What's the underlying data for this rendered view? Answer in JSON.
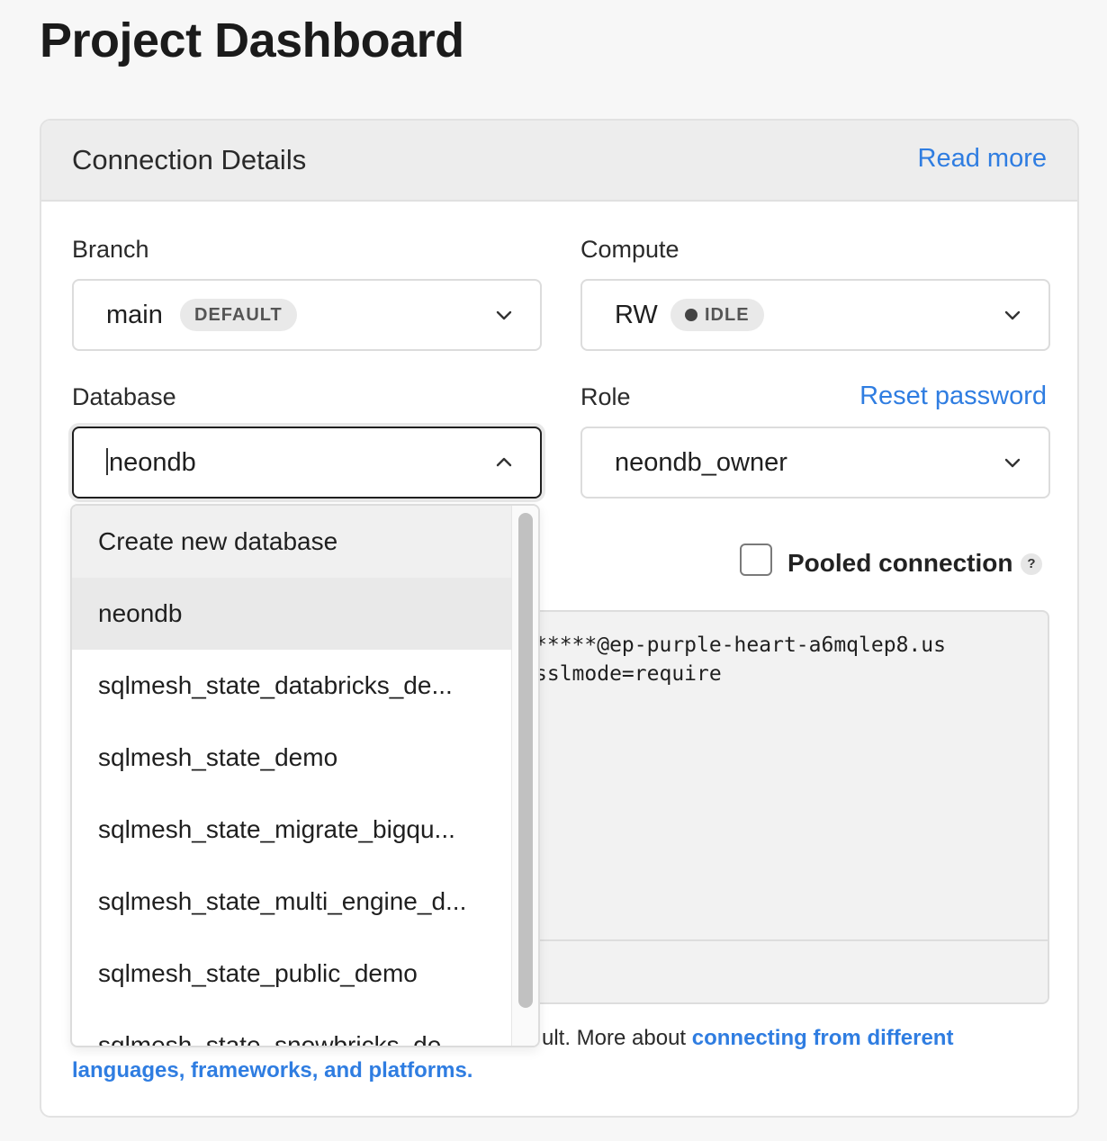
{
  "page": {
    "title": "Project Dashboard"
  },
  "connection": {
    "header_title": "Connection Details",
    "read_more": "Read more",
    "branch": {
      "label": "Branch",
      "value": "main",
      "badge": "DEFAULT"
    },
    "compute": {
      "label": "Compute",
      "value": "RW",
      "status": "IDLE"
    },
    "database": {
      "label": "Database",
      "value": "neondb",
      "options": [
        "Create new database",
        "neondb",
        "sqlmesh_state_databricks_de...",
        "sqlmesh_state_demo",
        "sqlmesh_state_migrate_bigqu...",
        "sqlmesh_state_multi_engine_d...",
        "sqlmesh_state_public_demo",
        "sqlmesh_state_snowbricks_de..."
      ]
    },
    "role": {
      "label": "Role",
      "value": "neondb_owner",
      "reset_password": "Reset password"
    },
    "pooled": {
      "label": "Pooled connection",
      "checked": false,
      "help": "?"
    },
    "code": {
      "line1": "*****@ep-purple-heart-a6mqlep8.us",
      "line2": "sslmode=require"
    },
    "footnote": {
      "text": "ult. More about ",
      "link": "connecting from different languages, frameworks, and platforms."
    }
  },
  "colors": {
    "accent": "#2f7de1",
    "header_bg": "#ededed",
    "code_bg": "#f2f2f2"
  },
  "icons": {
    "chevron": "chevron-down-icon",
    "chevron_up": "chevron-up-icon",
    "status": "status-dot-icon",
    "help": "question-icon"
  }
}
